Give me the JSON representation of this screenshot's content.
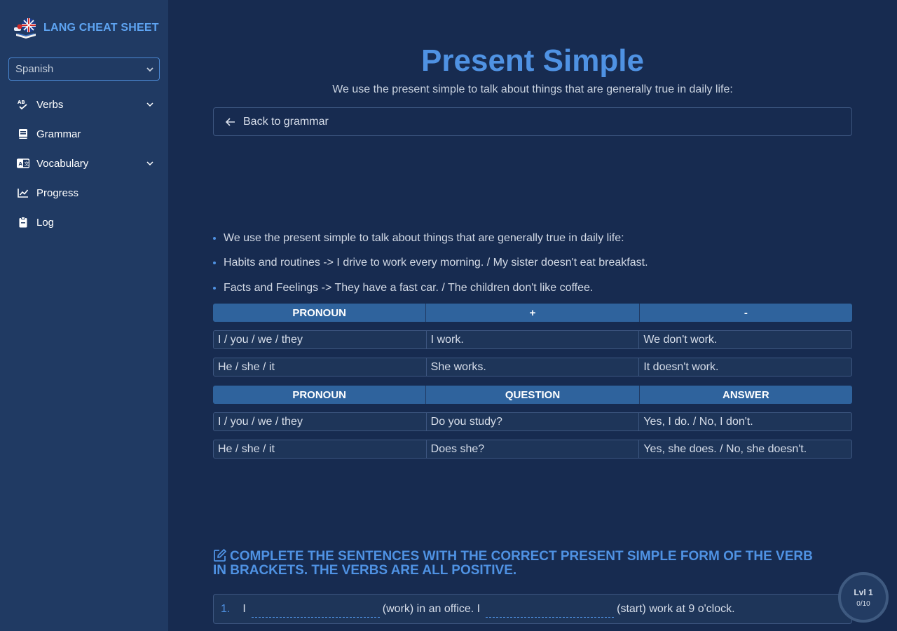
{
  "sidebar": {
    "brand": "LANG CHEAT SHEET",
    "language_select": {
      "value": "Spanish"
    },
    "items": [
      {
        "label": "Verbs",
        "icon": "spell-check-icon",
        "has_dropdown": true
      },
      {
        "label": "Grammar",
        "icon": "book-icon",
        "has_dropdown": false
      },
      {
        "label": "Vocabulary",
        "icon": "language-icon",
        "has_dropdown": true
      },
      {
        "label": "Progress",
        "icon": "chart-line-icon",
        "has_dropdown": false
      },
      {
        "label": "Log",
        "icon": "clipboard-icon",
        "has_dropdown": false
      }
    ]
  },
  "main": {
    "title": "Present Simple",
    "subtitle": "We use the present simple to talk about things that are generally true in daily life:",
    "back_label": "Back to grammar",
    "bullets": [
      "We use the present simple to talk about things that are generally true in daily life:",
      "Habits and routines -> I drive to work every morning. / My sister doesn't eat breakfast.",
      "Facts and Feelings -> They have a fast car. / The children don't like coffee."
    ],
    "table1": {
      "headers": [
        "PRONOUN",
        "+",
        "-"
      ],
      "rows": [
        [
          "I / you / we / they",
          "I work.",
          "We don't work."
        ],
        [
          "He / she / it",
          "She works.",
          "It doesn't work."
        ]
      ]
    },
    "table2": {
      "headers": [
        "PRONOUN",
        "QUESTION",
        "ANSWER"
      ],
      "rows": [
        [
          "I / you / we / they",
          "Do you study?",
          "Yes, I do. / No, I don't."
        ],
        [
          "He / she / it",
          "Does she?",
          "Yes, she does. / No, she doesn't."
        ]
      ]
    },
    "exercise": {
      "heading": "Complete the sentences with the correct present simple form of the verb in brackets. The verbs are all positive.",
      "items": [
        {
          "number": "1.",
          "part1": "I",
          "part2": "(work) in an office. I",
          "part3": "(start) work at 9 o'clock."
        }
      ]
    }
  },
  "level_badge": {
    "level": "Lvl 1",
    "score": "0/10"
  },
  "colors": {
    "background": "#172b50",
    "sidebar": "#203a63",
    "accent": "#4f92e3",
    "table_header": "#2f639d"
  }
}
